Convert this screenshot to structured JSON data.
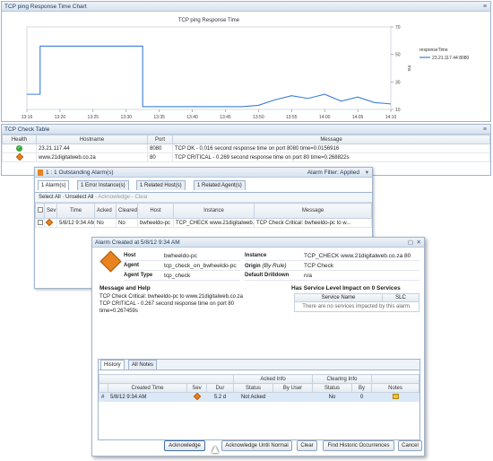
{
  "chart_panel": {
    "title": "TCP ping Response Time Chart"
  },
  "chart_data": {
    "type": "line",
    "title": "TCP ping Response Time",
    "ylabel": "ms",
    "x_ticks": [
      "13:16",
      "13:20",
      "13:25",
      "13:30",
      "13:35",
      "13:40",
      "13:45",
      "13:50",
      "13:55",
      "14:00",
      "14:05",
      "14:10"
    ],
    "y_ticks": [
      "70",
      "50",
      "30",
      "10"
    ],
    "ylim": [
      10,
      70
    ],
    "legend_title": "responseTime",
    "series": [
      {
        "name": "23.21.117.44:8080",
        "color": "#3b7dd8",
        "x": [
          0,
          0.4,
          0.4,
          3.5,
          3.5,
          4,
          4.5,
          5,
          5.5,
          6,
          6.5,
          7,
          7.5,
          8,
          8.5,
          9,
          9.5,
          10,
          10.5,
          11
        ],
        "y": [
          21,
          21,
          56,
          56,
          12,
          12,
          12,
          12,
          12,
          12,
          12,
          13,
          17,
          20,
          18,
          21,
          16,
          19,
          15,
          14
        ]
      }
    ]
  },
  "check_panel": {
    "title": "TCP Check Table",
    "columns": [
      "Health",
      "Hostname",
      "Port",
      "Message"
    ],
    "rows": [
      {
        "host": "23.21.117.44",
        "port": "8080",
        "message": "TCP OK - 0.016 second response time on port 8080 time=0.0156916",
        "status": "ok"
      },
      {
        "host": "www.21digitalweb.co.za",
        "port": "80",
        "message": "TCP CRITICAL - 0.269 second response time on port 80 time=0.268822s",
        "status": "critical"
      }
    ]
  },
  "alarms_window": {
    "title": "1 : 1 Outstanding Alarm(s)",
    "filter": "Alarm Filter: Applied",
    "tabs": [
      "1 Alarm(s)",
      "1 Error Instance(s)",
      "1 Related Host(s)",
      "1 Related Agent(s)"
    ],
    "toolbar": [
      "Select All",
      "Unselect All",
      "Acknowledge",
      "Clear"
    ],
    "columns": [
      "Sev",
      "Time",
      "Acked",
      "Cleared",
      "Host",
      "Instance",
      "Message"
    ],
    "row": {
      "time": "5/8/12 9:34 AM",
      "acked": "No",
      "cleared": "No",
      "host": "bwheeldo-pc",
      "instance": "TCP_CHECK www.21digitalweb.c...",
      "message": "TCP Check Critical: bwheeldo-pc to w..."
    }
  },
  "detail_window": {
    "title": "Alarm Created at 5/8/12 9:34 AM",
    "fields": {
      "host_label": "Host",
      "host": "bwheeldo-pc",
      "agent_label": "Agent",
      "agent": "tcp_check_on_bwheeldo-pc",
      "agent_type_label": "Agent Type",
      "agent_type": "tcp_check",
      "instance_label": "Instance",
      "instance": "TCP_CHECK www.21digitalweb.co.za 80",
      "origin_label": "Origin",
      "origin_hint": "(By Rule)",
      "origin": "TCP Check",
      "drilldown_label": "Default Drilldown",
      "drilldown": "n/a"
    },
    "message_heading": "Message and Help",
    "message": "TCP Check Critical: bwheeldo-pc to www.21digitalweb.co.za TCP CRITICAL - 0.267 second response time on port 80 time=0.267459s",
    "service_heading": "Has Service Level Impact on 0 Services",
    "service_columns": [
      "Service Name",
      "SLC"
    ],
    "service_empty": "There are no services impacted by this alarm.",
    "tabs": [
      "History",
      "All Notes"
    ],
    "history_groups": {
      "acked": "Acked Info",
      "clearing": "Clearing Info"
    },
    "history_columns": [
      "#",
      "Created Time",
      "Sev",
      "Dur",
      "Status",
      "By User",
      "Status",
      "By",
      "Notes"
    ],
    "history_row": {
      "num": "#",
      "created": "5/8/12 9:34 AM",
      "dur": "5.2 d",
      "acked": "Not Acked",
      "by_user": "",
      "clear_status": "No",
      "by": "0"
    },
    "buttons": [
      "Acknowledge",
      "Acknowledge Until Normal",
      "Clear",
      "Find Historic Occurrences",
      "Cancel"
    ]
  }
}
